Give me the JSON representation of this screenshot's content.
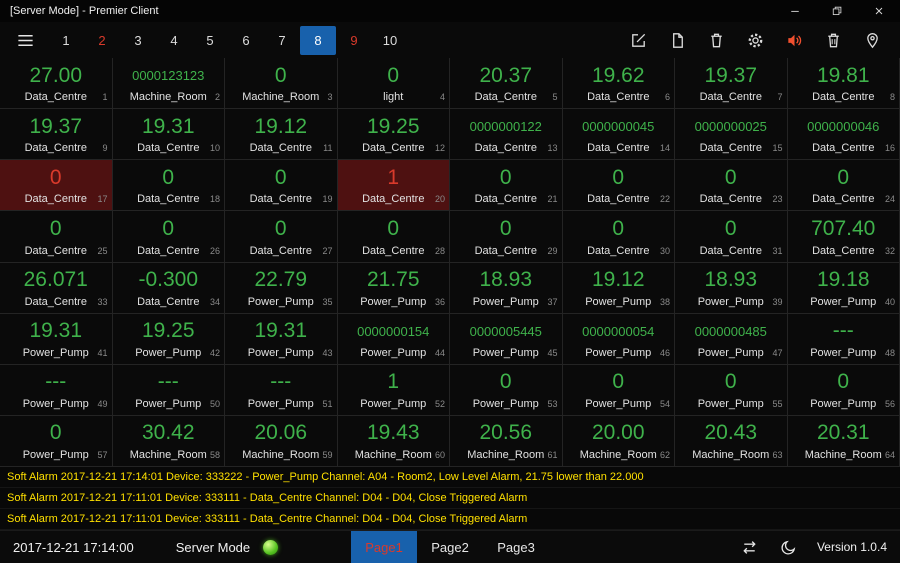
{
  "window": {
    "title": "[Server Mode] - Premier Client"
  },
  "colors": {
    "bg": "#0a0a0a",
    "grid-line": "#242424",
    "value-green": "#3fb24b",
    "text": "#e6e6e6",
    "muted": "#8a8a8a",
    "accent-blue": "#1861ac",
    "alarm-red": "#d93a2b",
    "alarm-bg": "#4e1111",
    "alarm-yellow": "#ffe000",
    "sound-orange": "#f1502f",
    "led-green": "#56c221"
  },
  "toolbar": {
    "pages": [
      {
        "label": "1"
      },
      {
        "label": "2",
        "state": "alarm"
      },
      {
        "label": "3"
      },
      {
        "label": "4"
      },
      {
        "label": "5"
      },
      {
        "label": "6"
      },
      {
        "label": "7"
      },
      {
        "label": "8",
        "state": "selected"
      },
      {
        "label": "9",
        "state": "alarm"
      },
      {
        "label": "10"
      }
    ],
    "icon_names": [
      "menu-icon",
      "edit-icon",
      "file-icon",
      "trash-icon",
      "settings-icon",
      "sound-icon",
      "clear-alarm-icon",
      "location-icon"
    ]
  },
  "grid": {
    "cells": [
      {
        "value": "27.00",
        "label": "Data_Centre",
        "index": "1"
      },
      {
        "value": "0000123123",
        "label": "Machine_Room",
        "index": "2"
      },
      {
        "value": "0",
        "label": "Machine_Room",
        "index": "3"
      },
      {
        "value": "0",
        "label": "light",
        "index": "4"
      },
      {
        "value": "20.37",
        "label": "Data_Centre",
        "index": "5"
      },
      {
        "value": "19.62",
        "label": "Data_Centre",
        "index": "6"
      },
      {
        "value": "19.37",
        "label": "Data_Centre",
        "index": "7"
      },
      {
        "value": "19.81",
        "label": "Data_Centre",
        "index": "8"
      },
      {
        "value": "19.37",
        "label": "Data_Centre",
        "index": "9"
      },
      {
        "value": "19.31",
        "label": "Data_Centre",
        "index": "10"
      },
      {
        "value": "19.12",
        "label": "Data_Centre",
        "index": "11"
      },
      {
        "value": "19.25",
        "label": "Data_Centre",
        "index": "12"
      },
      {
        "value": "0000000122",
        "label": "Data_Centre",
        "index": "13"
      },
      {
        "value": "0000000045",
        "label": "Data_Centre",
        "index": "14"
      },
      {
        "value": "0000000025",
        "label": "Data_Centre",
        "index": "15"
      },
      {
        "value": "0000000046",
        "label": "Data_Centre",
        "index": "16"
      },
      {
        "value": "0",
        "label": "Data_Centre",
        "index": "17",
        "state": "alarm"
      },
      {
        "value": "0",
        "label": "Data_Centre",
        "index": "18"
      },
      {
        "value": "0",
        "label": "Data_Centre",
        "index": "19"
      },
      {
        "value": "1",
        "label": "Data_Centre",
        "index": "20",
        "state": "alarm"
      },
      {
        "value": "0",
        "label": "Data_Centre",
        "index": "21"
      },
      {
        "value": "0",
        "label": "Data_Centre",
        "index": "22"
      },
      {
        "value": "0",
        "label": "Data_Centre",
        "index": "23"
      },
      {
        "value": "0",
        "label": "Data_Centre",
        "index": "24"
      },
      {
        "value": "0",
        "label": "Data_Centre",
        "index": "25"
      },
      {
        "value": "0",
        "label": "Data_Centre",
        "index": "26"
      },
      {
        "value": "0",
        "label": "Data_Centre",
        "index": "27"
      },
      {
        "value": "0",
        "label": "Data_Centre",
        "index": "28"
      },
      {
        "value": "0",
        "label": "Data_Centre",
        "index": "29"
      },
      {
        "value": "0",
        "label": "Data_Centre",
        "index": "30"
      },
      {
        "value": "0",
        "label": "Data_Centre",
        "index": "31"
      },
      {
        "value": "707.40",
        "label": "Data_Centre",
        "index": "32"
      },
      {
        "value": "26.071",
        "label": "Data_Centre",
        "index": "33"
      },
      {
        "value": "-0.300",
        "label": "Data_Centre",
        "index": "34"
      },
      {
        "value": "22.79",
        "label": "Power_Pump",
        "index": "35"
      },
      {
        "value": "21.75",
        "label": "Power_Pump",
        "index": "36"
      },
      {
        "value": "18.93",
        "label": "Power_Pump",
        "index": "37"
      },
      {
        "value": "19.12",
        "label": "Power_Pump",
        "index": "38"
      },
      {
        "value": "18.93",
        "label": "Power_Pump",
        "index": "39"
      },
      {
        "value": "19.18",
        "label": "Power_Pump",
        "index": "40"
      },
      {
        "value": "19.31",
        "label": "Power_Pump",
        "index": "41"
      },
      {
        "value": "19.25",
        "label": "Power_Pump",
        "index": "42"
      },
      {
        "value": "19.31",
        "label": "Power_Pump",
        "index": "43"
      },
      {
        "value": "0000000154",
        "label": "Power_Pump",
        "index": "44"
      },
      {
        "value": "0000005445",
        "label": "Power_Pump",
        "index": "45"
      },
      {
        "value": "0000000054",
        "label": "Power_Pump",
        "index": "46"
      },
      {
        "value": "0000000485",
        "label": "Power_Pump",
        "index": "47"
      },
      {
        "value": "---",
        "label": "Power_Pump",
        "index": "48"
      },
      {
        "value": "---",
        "label": "Power_Pump",
        "index": "49"
      },
      {
        "value": "---",
        "label": "Power_Pump",
        "index": "50"
      },
      {
        "value": "---",
        "label": "Power_Pump",
        "index": "51"
      },
      {
        "value": "1",
        "label": "Power_Pump",
        "index": "52"
      },
      {
        "value": "0",
        "label": "Power_Pump",
        "index": "53"
      },
      {
        "value": "0",
        "label": "Power_Pump",
        "index": "54"
      },
      {
        "value": "0",
        "label": "Power_Pump",
        "index": "55"
      },
      {
        "value": "0",
        "label": "Power_Pump",
        "index": "56"
      },
      {
        "value": "0",
        "label": "Power_Pump",
        "index": "57"
      },
      {
        "value": "30.42",
        "label": "Machine_Room",
        "index": "58"
      },
      {
        "value": "20.06",
        "label": "Machine_Room",
        "index": "59"
      },
      {
        "value": "19.43",
        "label": "Machine_Room",
        "index": "60"
      },
      {
        "value": "20.56",
        "label": "Machine_Room",
        "index": "61"
      },
      {
        "value": "20.00",
        "label": "Machine_Room",
        "index": "62"
      },
      {
        "value": "20.43",
        "label": "Machine_Room",
        "index": "63"
      },
      {
        "value": "20.31",
        "label": "Machine_Room",
        "index": "64"
      }
    ]
  },
  "alarms": [
    {
      "text": "Soft Alarm 2017-12-21 17:14:01 Device: 333222 - Power_Pump Channel: A04 - Room2, Low Level Alarm, 21.75 lower than 22.000"
    },
    {
      "text": "Soft Alarm 2017-12-21 17:11:01 Device: 333111 - Data_Centre Channel: D04 - D04, Close Triggered Alarm"
    },
    {
      "text": "Soft Alarm 2017-12-21 17:11:01 Device: 333111 - Data_Centre Channel: D04 - D04, Close Triggered Alarm"
    }
  ],
  "statusbar": {
    "timestamp": "2017-12-21 17:14:00",
    "mode_label": "Server Mode",
    "tabs": [
      {
        "label": "Page1",
        "state": "active"
      },
      {
        "label": "Page2"
      },
      {
        "label": "Page3"
      }
    ],
    "icon_names": [
      "sync-icon",
      "night-mode-icon"
    ],
    "version": "Version 1.0.4"
  }
}
